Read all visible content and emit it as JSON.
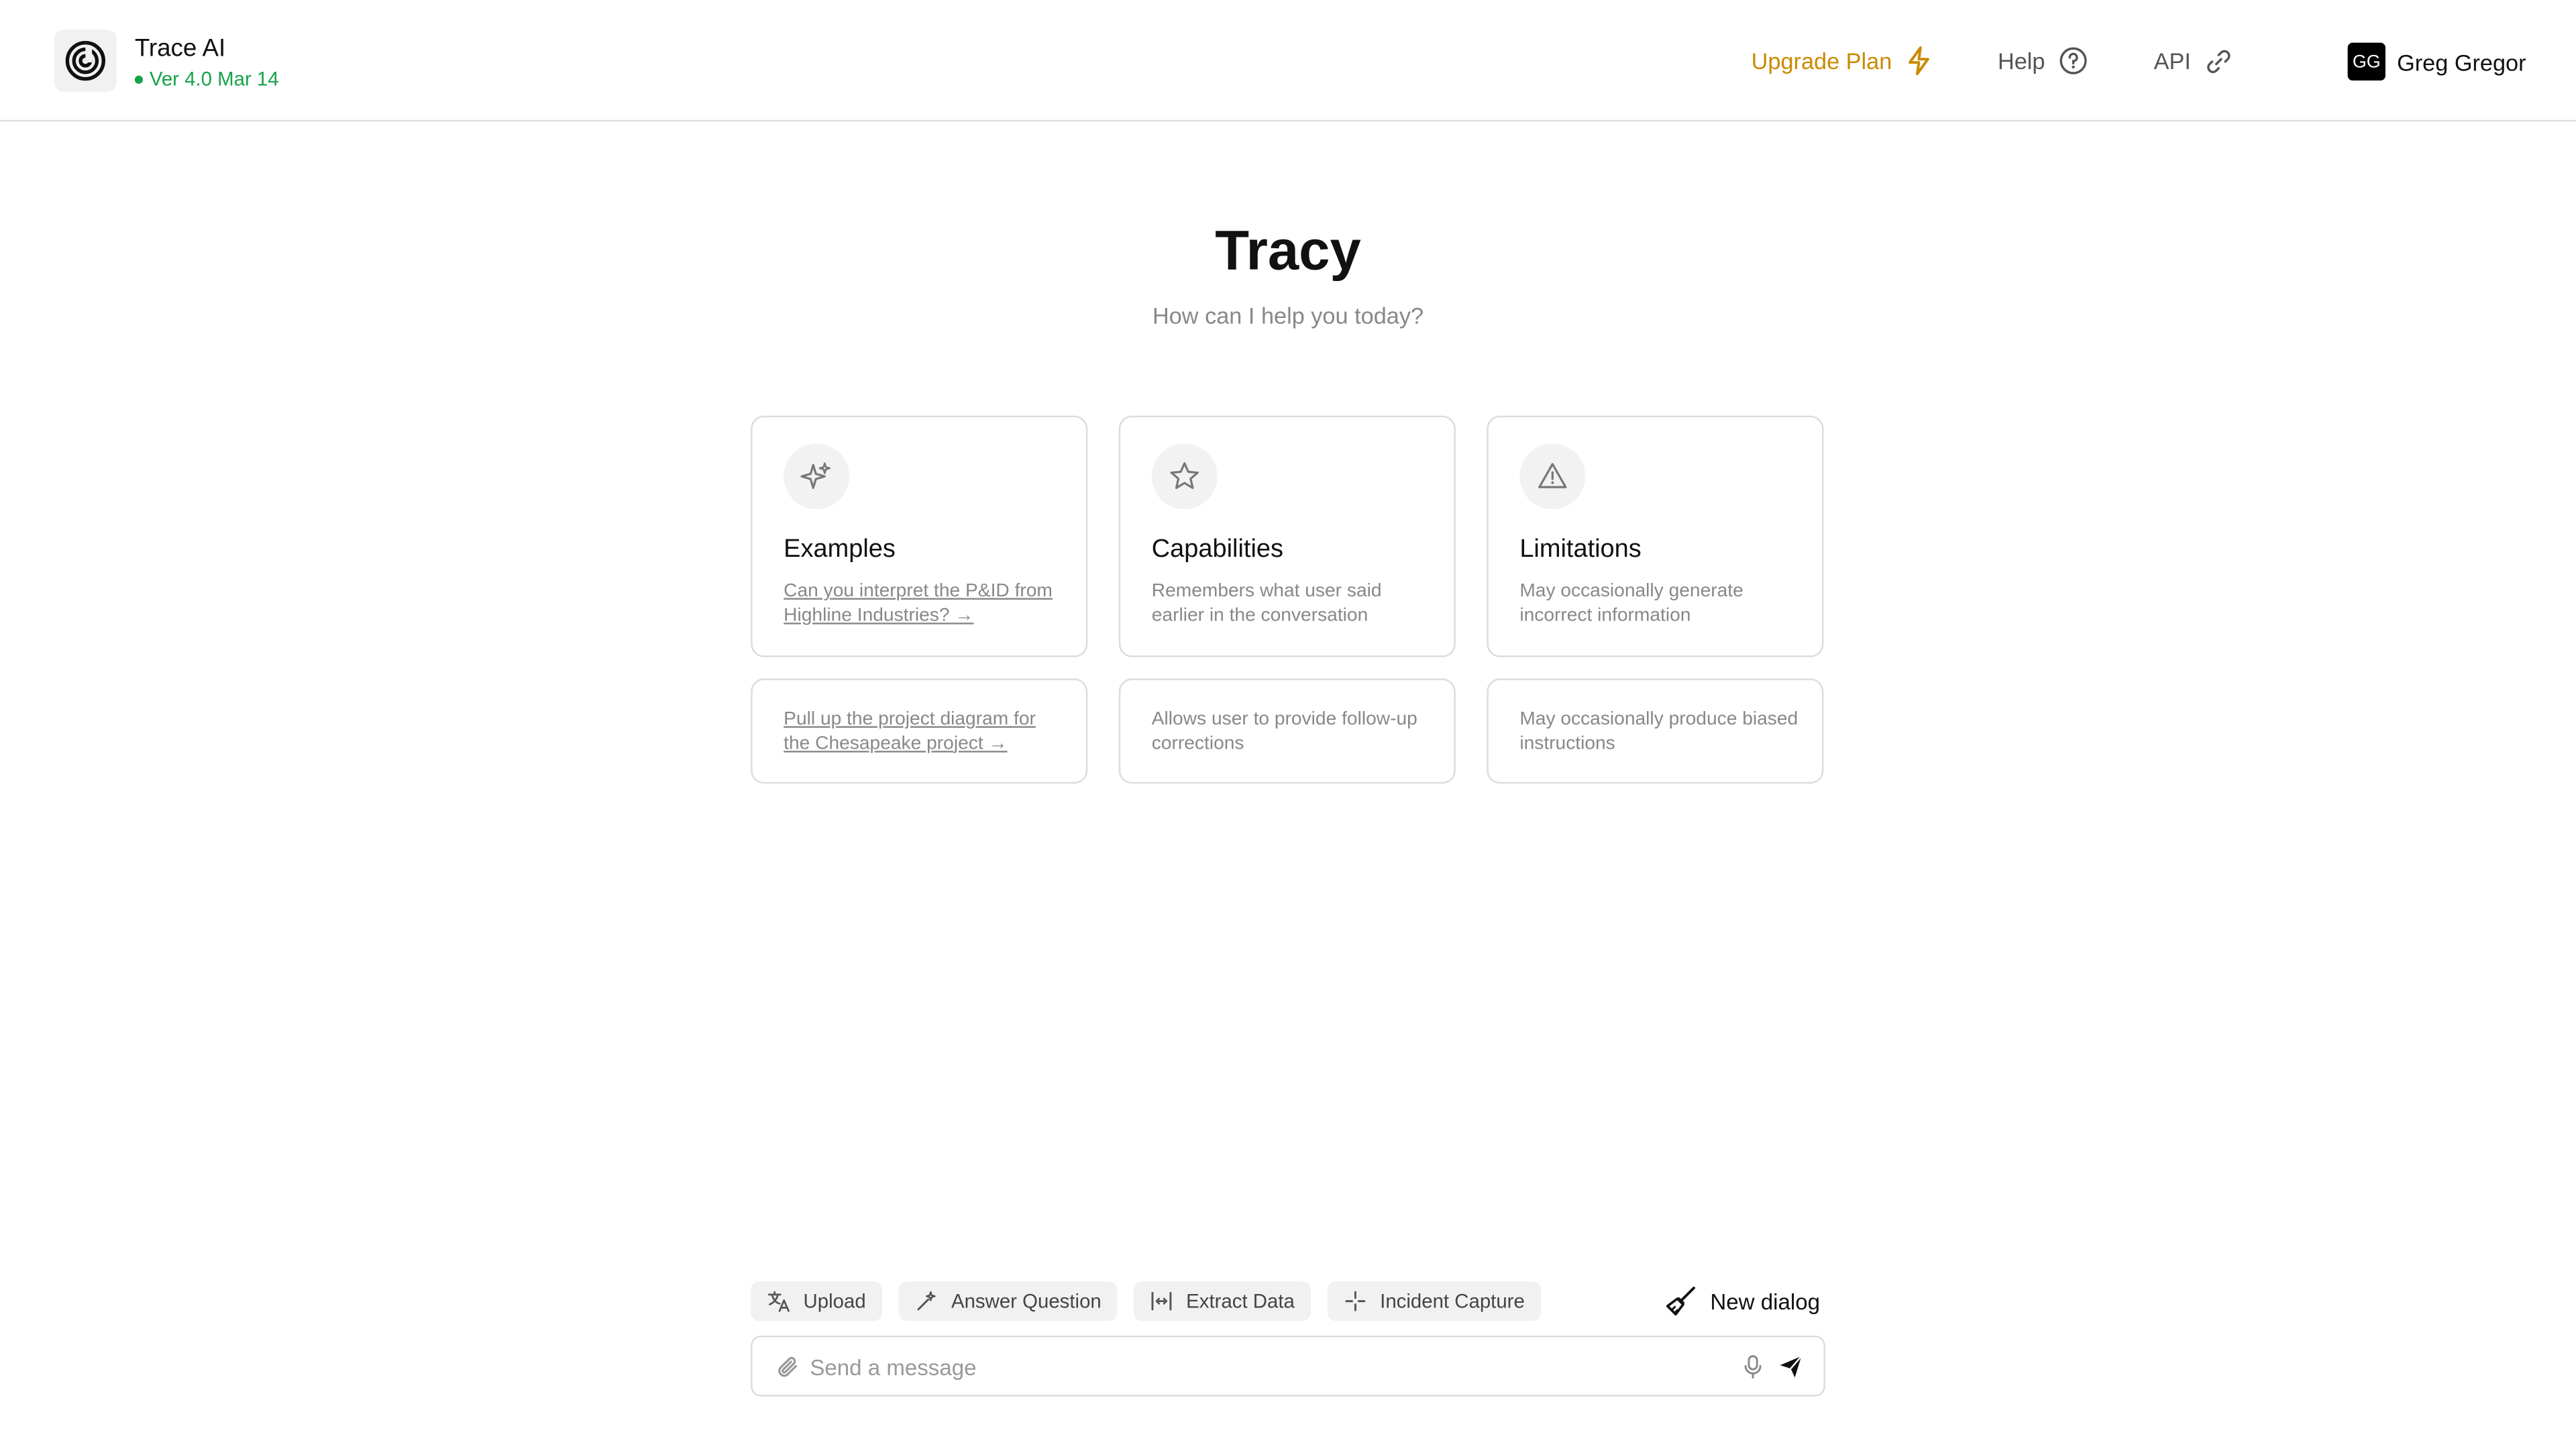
{
  "app": {
    "title": "Trace AI",
    "version": "Ver 4.0 Mar 14",
    "version_status_color": "#16a34a"
  },
  "nav": {
    "upgrade_label": "Upgrade Plan",
    "help_label": "Help",
    "api_label": "API",
    "accent_color": "#ca8a04"
  },
  "user": {
    "initials": "GG",
    "name": "Greg Gregor"
  },
  "hero": {
    "title": "Tracy",
    "subtitle": "How can I help you today?"
  },
  "cards": {
    "examples": {
      "icon": "sparkles-icon",
      "heading": "Examples",
      "items": [
        "Can you interpret the P&ID from Highline Industries? →",
        "Pull up the project diagram for the Chesapeake project →"
      ]
    },
    "capabilities": {
      "icon": "star-icon",
      "heading": "Capabilities",
      "items": [
        "Remembers what user said earlier in the conversation",
        "Allows user to provide follow-up corrections"
      ]
    },
    "limitations": {
      "icon": "warning-icon",
      "heading": "Limitations",
      "items": [
        "May occasionally generate incorrect information",
        "May occasionally produce biased instructions"
      ]
    }
  },
  "actions": {
    "upload": "Upload",
    "answer_question": "Answer Question",
    "extract_data": "Extract Data",
    "incident_capture": "Incident Capture",
    "new_dialog": "New dialog"
  },
  "composer": {
    "placeholder": "Send a message",
    "value": ""
  }
}
